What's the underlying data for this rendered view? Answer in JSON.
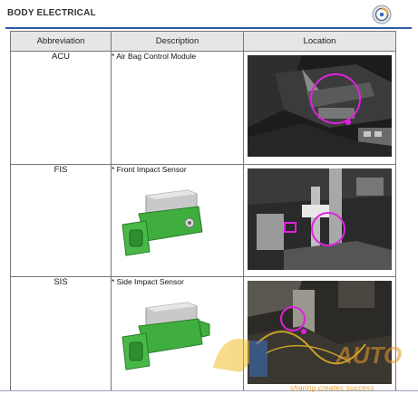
{
  "header": {
    "title": "BODY ELECTRICAL",
    "logo_icon": "globe-logo-icon"
  },
  "table": {
    "columns": [
      "Abbreviation",
      "Description",
      "Location"
    ],
    "rows": [
      {
        "abbreviation": "ACU",
        "description": "* Air Bag Control Module",
        "part_image": null,
        "photo": "acu-location-photo"
      },
      {
        "abbreviation": "FIS",
        "description": "* Front Impact Sensor",
        "part_image": "impact-sensor-render",
        "photo": "fis-location-photo"
      },
      {
        "abbreviation": "SIS",
        "description": "* Side Impact Sensor",
        "part_image": "impact-sensor-render",
        "photo": "sis-location-photo"
      }
    ]
  },
  "watermark": {
    "brand": "AUTO",
    "tagline": "sharing creates success"
  },
  "colors": {
    "rule": "#2b5aa6",
    "highlight_circle": "#e020e0",
    "sensor_body": "#3fae3f",
    "watermark_orange": "#e79b2a"
  }
}
